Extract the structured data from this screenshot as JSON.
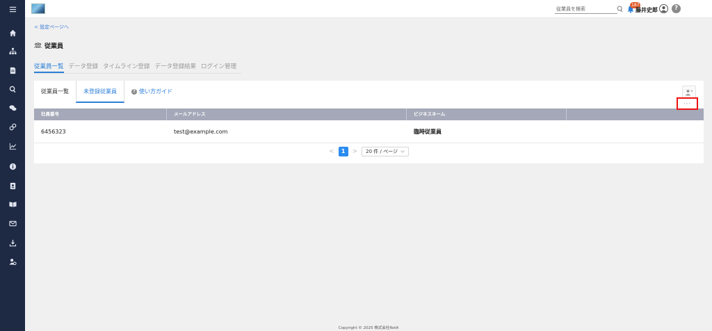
{
  "sidebar": {
    "items": [
      {
        "icon": "menu-icon"
      },
      {
        "icon": "home-icon"
      },
      {
        "icon": "org-chart-icon"
      },
      {
        "icon": "document-icon"
      },
      {
        "icon": "search-icon"
      },
      {
        "icon": "chat-icon"
      },
      {
        "icon": "link-icon"
      },
      {
        "icon": "chart-icon"
      },
      {
        "icon": "info-icon"
      },
      {
        "icon": "contacts-icon"
      },
      {
        "icon": "book-icon"
      },
      {
        "icon": "mail-icon"
      },
      {
        "icon": "download-icon"
      },
      {
        "icon": "user-settings-icon"
      }
    ],
    "bg_color": "#1e2a44"
  },
  "header": {
    "search_placeholder": "従業員を検索",
    "notification_count": "187",
    "user_name": "藤井史郎",
    "help_label": "?"
  },
  "breadcrumb": {
    "back_label": "< 設定ページへ"
  },
  "page": {
    "title": "従業員"
  },
  "top_tabs": [
    {
      "label": "従業員一覧",
      "active": true
    },
    {
      "label": "データ登録",
      "active": false
    },
    {
      "label": "タイムライン登録",
      "active": false
    },
    {
      "label": "データ登録結果",
      "active": false
    },
    {
      "label": "ログイン管理",
      "active": false
    }
  ],
  "sub_tabs": [
    {
      "label": "従業員一覧"
    },
    {
      "label": "未登録従業員"
    },
    {
      "label": "使い方ガイド"
    }
  ],
  "table": {
    "columns": [
      "社員番号",
      "メールアドレス",
      "ビジネスネーム",
      ""
    ],
    "rows": [
      {
        "employee_no": "6456323",
        "email": "test@example.com",
        "business_name": "臨時従業員",
        "more": "···"
      }
    ]
  },
  "pagination": {
    "prev": "<",
    "current": "1",
    "next": ">",
    "page_size": "20 件 / ページ"
  },
  "footer": {
    "copyright": "Copyright © 2025 株式会社RotA"
  },
  "colors": {
    "accent": "#2b7fd8",
    "header_row": "#a4a8b8",
    "highlight_border": "#ee1111"
  }
}
